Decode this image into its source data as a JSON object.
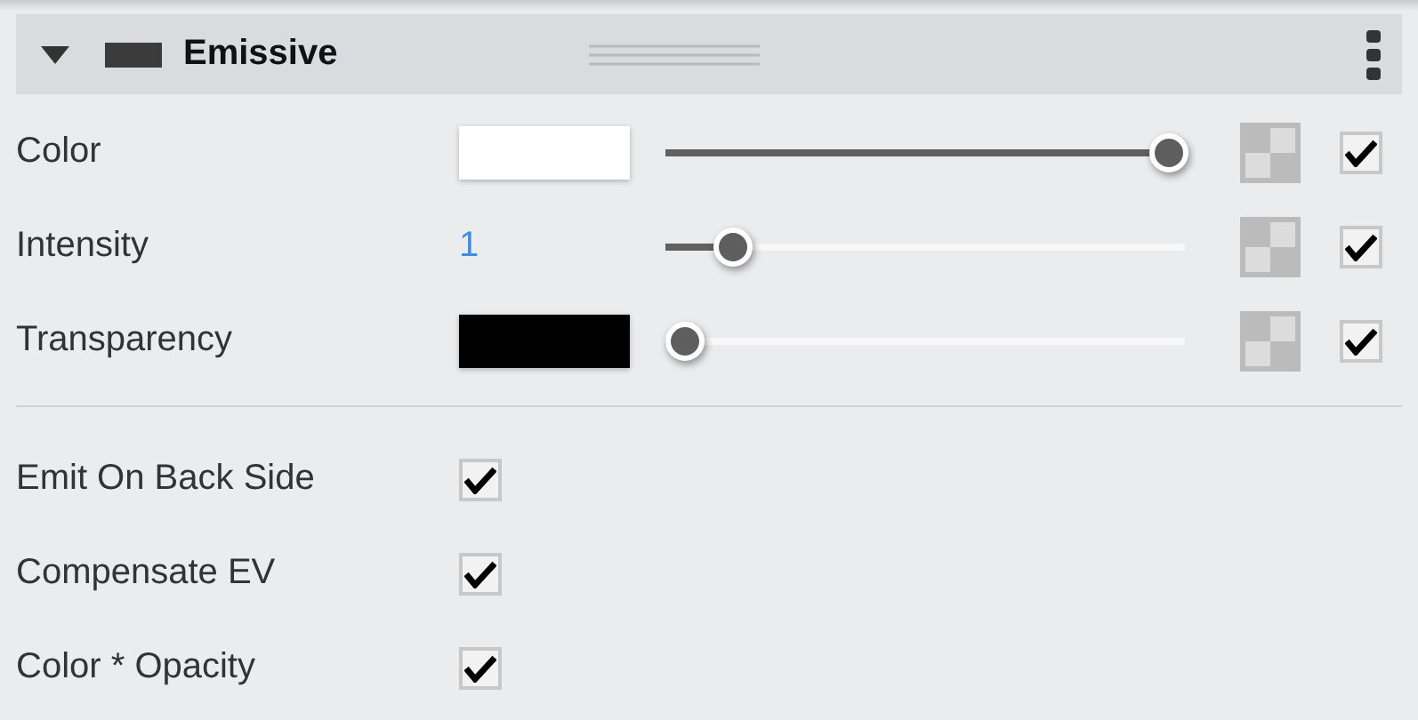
{
  "section": {
    "title": "Emissive",
    "expanded": true
  },
  "properties": [
    {
      "label": "Color",
      "kind": "color",
      "color": "#ffffff",
      "level": 1,
      "checked": true
    },
    {
      "label": "Intensity",
      "kind": "number",
      "value": "1",
      "level": 0.1,
      "checked": true
    },
    {
      "label": "Transparency",
      "kind": "color",
      "color": "#000000",
      "level": 0,
      "checked": true
    }
  ],
  "options": [
    {
      "label": "Emit On Back Side",
      "checked": true
    },
    {
      "label": "Compensate EV",
      "checked": true
    },
    {
      "label": "Color * Opacity",
      "checked": true
    }
  ]
}
